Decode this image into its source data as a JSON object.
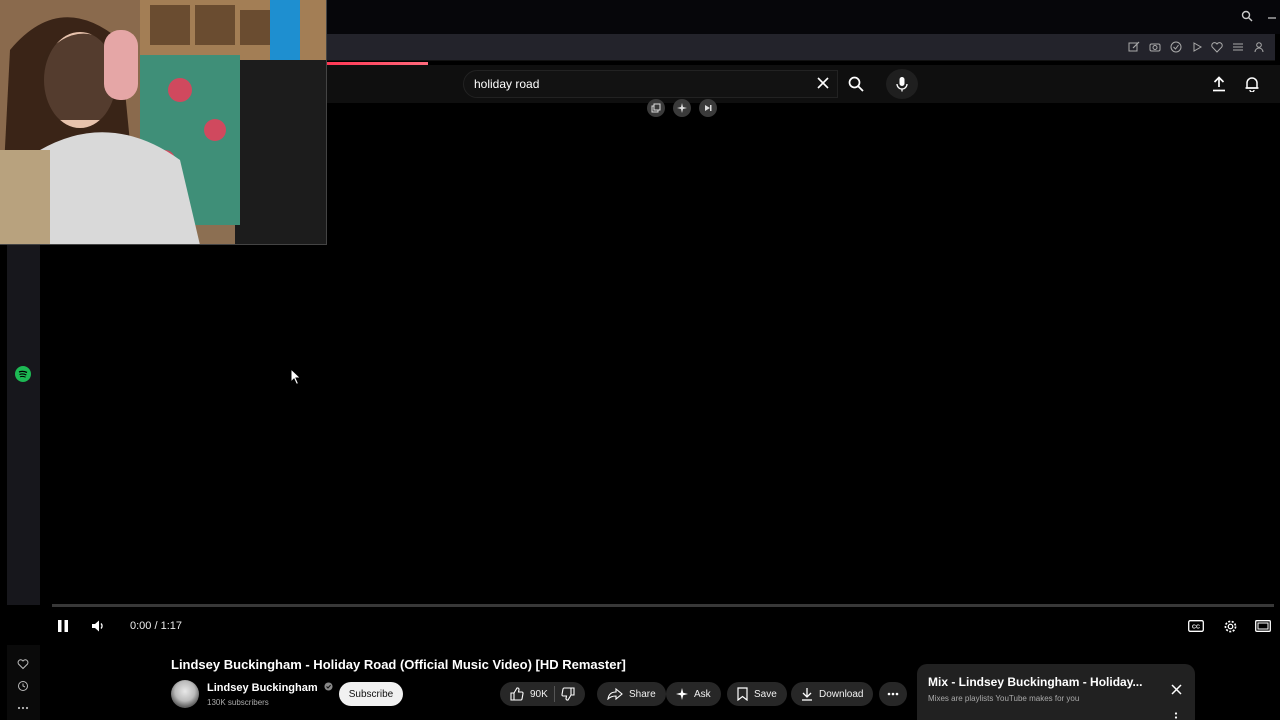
{
  "browser": {
    "titlebar_icons": [
      "search-icon",
      "minimize-icon"
    ],
    "extension_icons": [
      "edit-icon",
      "camera-icon",
      "shield-icon",
      "play-icon",
      "heart-icon",
      "menu-icon",
      "profile-icon"
    ],
    "loading_color": "#ff2a4a"
  },
  "masthead": {
    "search_value": "holiday road",
    "icons": [
      "clear-icon",
      "search-icon",
      "mic-icon",
      "upload-icon",
      "bell-icon"
    ]
  },
  "player": {
    "time": "0:00 / 1:17",
    "progress_fraction": 0,
    "overlay_icons": [
      "copy-icon",
      "sparkle-icon",
      "next-icon"
    ],
    "control_icons": [
      "pause-icon",
      "volume-icon",
      "captions-icon",
      "settings-icon",
      "theater-icon"
    ]
  },
  "video": {
    "title": "Lindsey Buckingham - Holiday Road (Official Music Video) [HD Remaster]",
    "channel": "Lindsey Buckingham",
    "verified": true,
    "subscribers": "130K subscribers",
    "subscribe_label": "Subscribe",
    "like_count": "90K",
    "share_label": "Share",
    "ask_label": "Ask",
    "save_label": "Save",
    "download_label": "Download"
  },
  "mix": {
    "title": "Mix - Lindsey Buckingham - Holiday...",
    "subtitle": "Mixes are playlists YouTube makes for you"
  },
  "rail": {
    "app_icons": [
      "spotify-icon",
      "heart-icon",
      "history-icon",
      "more-icon"
    ],
    "spotify_color": "#1db954"
  }
}
